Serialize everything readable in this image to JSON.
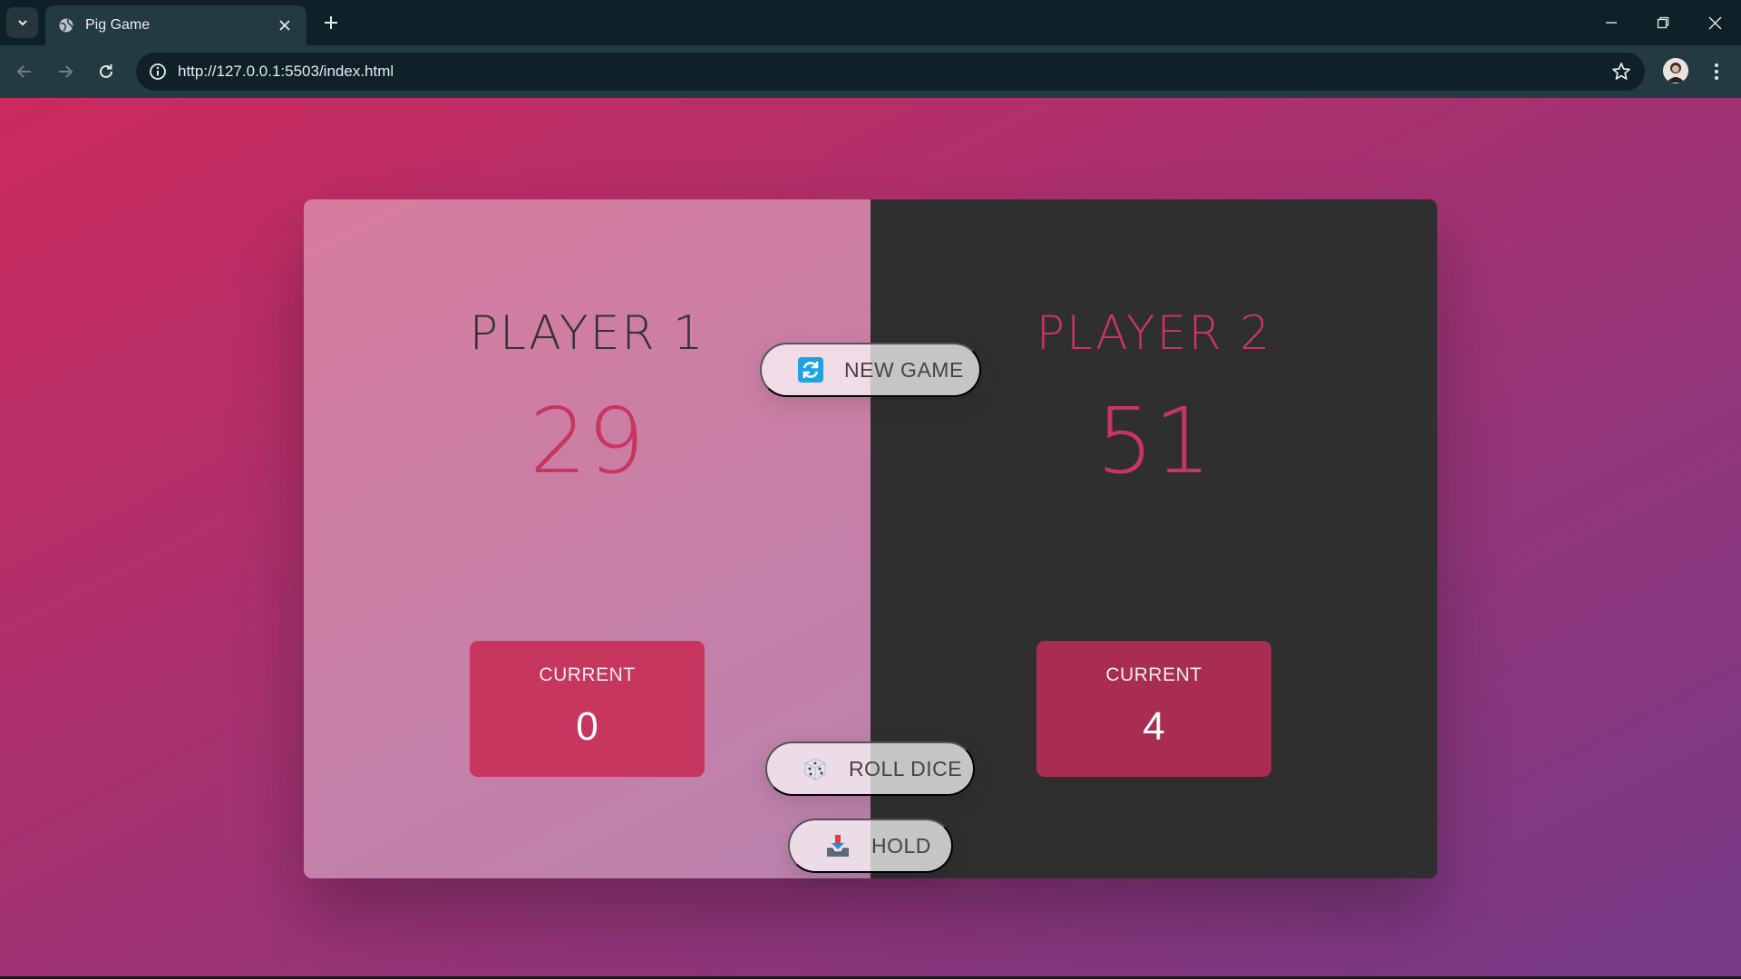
{
  "browser": {
    "tab_title": "Pig Game",
    "url": "http://127.0.0.1:5503/index.html"
  },
  "game": {
    "new_game_label": "NEW GAME",
    "roll_dice_label": "ROLL DICE",
    "hold_label": "HOLD",
    "active_player": 1,
    "players": [
      {
        "name": "PLAYER 1",
        "score": "29",
        "current_label": "CURRENT",
        "current_score": "0"
      },
      {
        "name": "PLAYER 2",
        "score": "51",
        "current_label": "CURRENT",
        "current_score": "4"
      }
    ]
  },
  "icons": {
    "tab_list": "chevron-down-icon",
    "favicon": "globe-icon",
    "tab_close": "close-icon",
    "new_tab": "plus-icon",
    "minimize": "minimize-icon",
    "restore": "restore-icon",
    "close_window": "close-icon",
    "back": "arrow-left-icon",
    "forward": "arrow-right-icon",
    "reload": "reload-icon",
    "site_info": "info-icon",
    "bookmark": "star-icon",
    "profile": "avatar",
    "menu": "kebab-menu-icon",
    "new_game": "refresh-icon",
    "roll_dice": "dice-icon",
    "hold": "inbox-tray-icon"
  },
  "colors": {
    "gradient_start": "#cc2b5e",
    "gradient_end": "#753a88",
    "accent": "#c7365f",
    "dark_panel": "#2f2f2f",
    "browser_frame": "#0f2128"
  }
}
